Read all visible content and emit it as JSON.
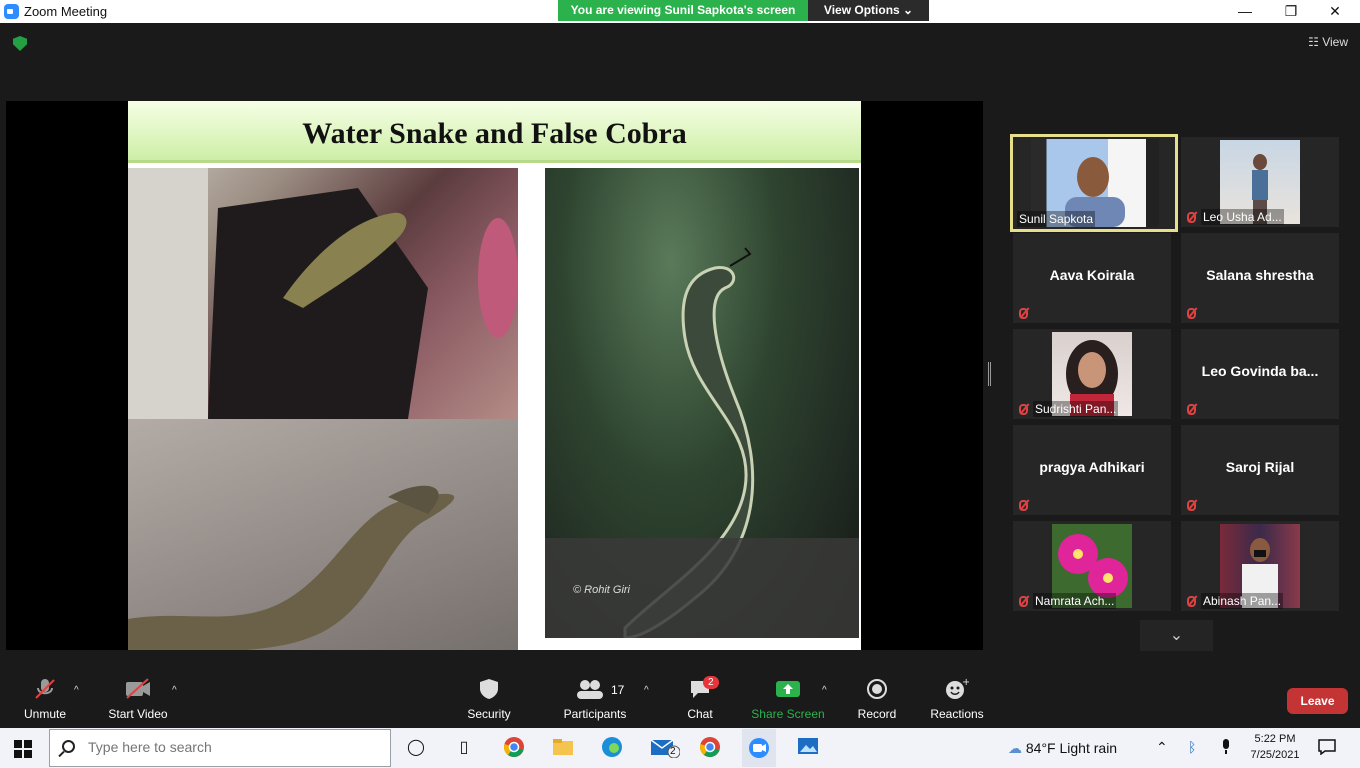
{
  "window": {
    "title": "Zoom Meeting"
  },
  "banner": {
    "viewing": "You are viewing Sunil Sapkota's screen",
    "view_options": "View Options ⌄"
  },
  "view_button": "☷ View",
  "slide": {
    "title": "Water Snake and False Cobra",
    "credit": "© Rohit Giri"
  },
  "participants_panel": [
    {
      "name": "Sunil Sapkota",
      "mode": "video",
      "active": true,
      "muted": false
    },
    {
      "name": "Leo Usha Ad...",
      "mode": "video",
      "active": false,
      "muted": true
    },
    {
      "name": "Aava Koirala",
      "mode": "name",
      "active": false,
      "muted": true
    },
    {
      "name": "Salana shrestha",
      "mode": "name",
      "active": false,
      "muted": true
    },
    {
      "name": "Sudrishti Pan...",
      "mode": "video",
      "active": false,
      "muted": true
    },
    {
      "name": "Leo Govinda ba...",
      "mode": "name",
      "active": false,
      "muted": true
    },
    {
      "name": "pragya Adhikari",
      "mode": "name",
      "active": false,
      "muted": true
    },
    {
      "name": "Saroj Rijal",
      "mode": "name",
      "active": false,
      "muted": true
    },
    {
      "name": "Namrata Ach...",
      "mode": "video",
      "active": false,
      "muted": true
    },
    {
      "name": "Abinash Pan...",
      "mode": "video",
      "active": false,
      "muted": true
    }
  ],
  "toolbar": {
    "unmute": "Unmute",
    "start_video": "Start Video",
    "security": "Security",
    "participants": "Participants",
    "participants_count": "17",
    "chat": "Chat",
    "chat_badge": "2",
    "share_screen": "Share Screen",
    "record": "Record",
    "reactions": "Reactions",
    "leave": "Leave"
  },
  "taskbar": {
    "search_placeholder": "Type here to search",
    "weather": "84°F  Light rain",
    "time": "5:22 PM",
    "date": "7/25/2021",
    "mail_badge": "2"
  },
  "colors": {
    "zoom_blue": "#2d8cff",
    "banner_green": "#2bb24c",
    "leave_red": "#c53434",
    "active_border": "#e7e08a",
    "share_green": "#2bb24c"
  }
}
